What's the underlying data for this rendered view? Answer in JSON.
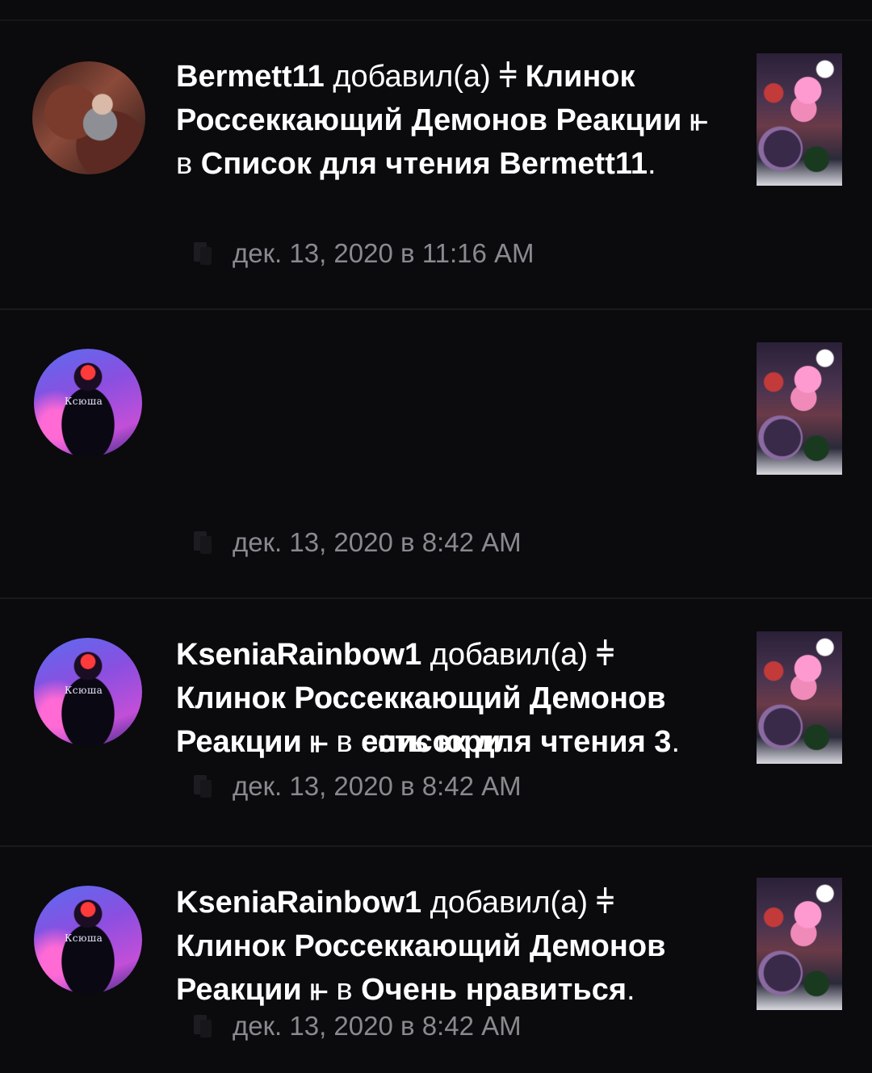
{
  "feed": [
    {
      "username": "Bermett11",
      "verb": "добавил(а)",
      "title_prefix": "⫩",
      "title": "Клинок Россеккающий Демонов Реакции",
      "title_suffix": "⫦",
      "preposition": "в",
      "list_name": "Список для чтения Bermett11",
      "period": ".",
      "timestamp": "дек. 13, 2020 в 11:16 AM",
      "avatar_icon": "user-avatar-anime",
      "thumb_icon": "book-cover"
    },
    {
      "username": "KseniaRainbow1",
      "verb": "добавил(а)",
      "title_prefix": "⫩",
      "title": "Клинок Россеккающий Демонов Реакции",
      "title_suffix": "⫦",
      "preposition": "в",
      "list_name": "список для чтения 3",
      "period": ".",
      "avatar_tag": "Ксюша",
      "timestamp": "дек. 13, 2020 в 8:42 AM",
      "avatar_icon": "user-avatar-neon",
      "thumb_icon": "book-cover"
    },
    {
      "username": "KseniaRainbow1",
      "verb": "добавил(а)",
      "title_prefix": "⫩",
      "title": "Клинок Россеккающий Демонов Реакции",
      "title_suffix": "⫦",
      "preposition": "в",
      "list_name": "есть юри",
      "period": ".",
      "avatar_tag": "Ксюша",
      "timestamp": "дек. 13, 2020 в 8:42 AM",
      "avatar_icon": "user-avatar-neon",
      "thumb_icon": "book-cover"
    },
    {
      "username": "KseniaRainbow1",
      "verb": "добавил(а)",
      "title_prefix": "⫩",
      "title": "Клинок Россеккающий Демонов Реакции",
      "title_suffix": "⫦",
      "preposition": "в",
      "list_name": "Очень нравиться",
      "period": ".",
      "avatar_tag": "Ксюша",
      "timestamp": "дек. 13, 2020 в 8:42 AM",
      "avatar_icon": "user-avatar-neon",
      "thumb_icon": "book-cover"
    }
  ],
  "colors": {
    "background": "#0b0a0d",
    "divider": "#1a191d",
    "text_primary": "#ffffff",
    "text_secondary": "#8a898f"
  }
}
